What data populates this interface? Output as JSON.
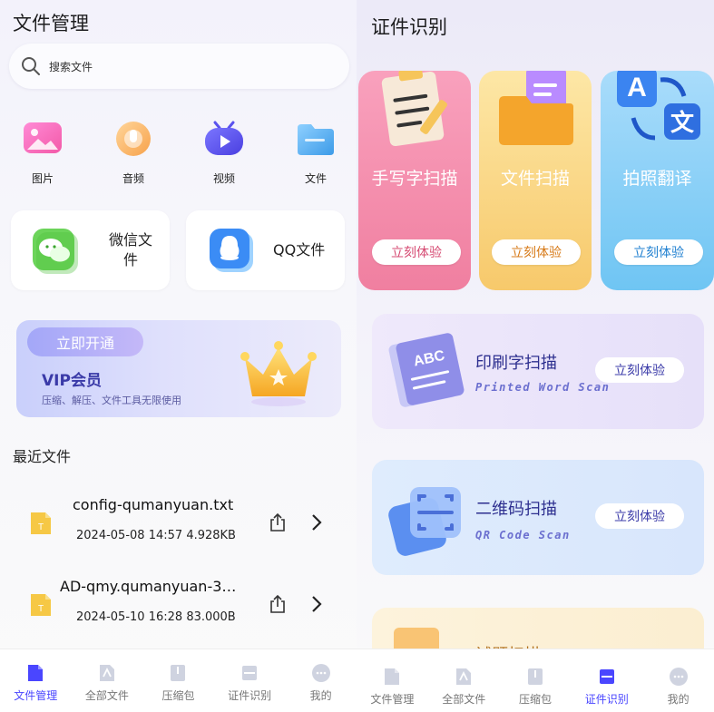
{
  "left": {
    "title": "文件管理",
    "search": {
      "placeholder": "搜索文件"
    },
    "categories": [
      {
        "label": "图片",
        "icon": "image-icon"
      },
      {
        "label": "音频",
        "icon": "audio-icon"
      },
      {
        "label": "视频",
        "icon": "video-icon"
      },
      {
        "label": "文件",
        "icon": "folder-icon"
      }
    ],
    "apps": [
      {
        "label": "微信文件",
        "icon": "wechat-icon"
      },
      {
        "label": "QQ文件",
        "icon": "qq-icon"
      }
    ],
    "vip": {
      "pill": "立即开通",
      "title": "VIP会员",
      "subtitle": "压缩、解压、文件工具无限使用"
    },
    "recent_title": "最近文件",
    "recent": [
      {
        "name": "config-qumanyuan.txt",
        "date": "2024-05-08",
        "time": "14:57",
        "size": "4.928KB"
      },
      {
        "name": "AD-qmy.qumanyuan-3…",
        "date": "2024-05-10",
        "time": "16:28",
        "size": "83.000B"
      }
    ],
    "nav": [
      {
        "label": "文件管理",
        "active": true
      },
      {
        "label": "全部文件",
        "active": false
      },
      {
        "label": "压缩包",
        "active": false
      },
      {
        "label": "证件识别",
        "active": false
      },
      {
        "label": "我的",
        "active": false
      }
    ]
  },
  "right": {
    "title": "证件识别",
    "features": [
      {
        "title": "手写字扫描",
        "button": "立刻体验"
      },
      {
        "title": "文件扫描",
        "button": "立刻体验"
      },
      {
        "title": "拍照翻译",
        "button": "立刻体验"
      }
    ],
    "wide": [
      {
        "title": "印刷字扫描",
        "subtitle": "Printed Word Scan",
        "button": "立刻体验"
      },
      {
        "title": "二维码扫描",
        "subtitle": "QR Code Scan",
        "button": "立刻体验"
      },
      {
        "title": "试题扫描"
      }
    ],
    "nav": [
      {
        "label": "文件管理",
        "active": false
      },
      {
        "label": "全部文件",
        "active": false
      },
      {
        "label": "压缩包",
        "active": false
      },
      {
        "label": "证件识别",
        "active": true
      },
      {
        "label": "我的",
        "active": false
      }
    ]
  },
  "colors": {
    "accent": "#4a46ff",
    "handwrite_card": "#f07fa0",
    "file_card": "#f7c96b",
    "translate_card": "#6fc5f3"
  }
}
